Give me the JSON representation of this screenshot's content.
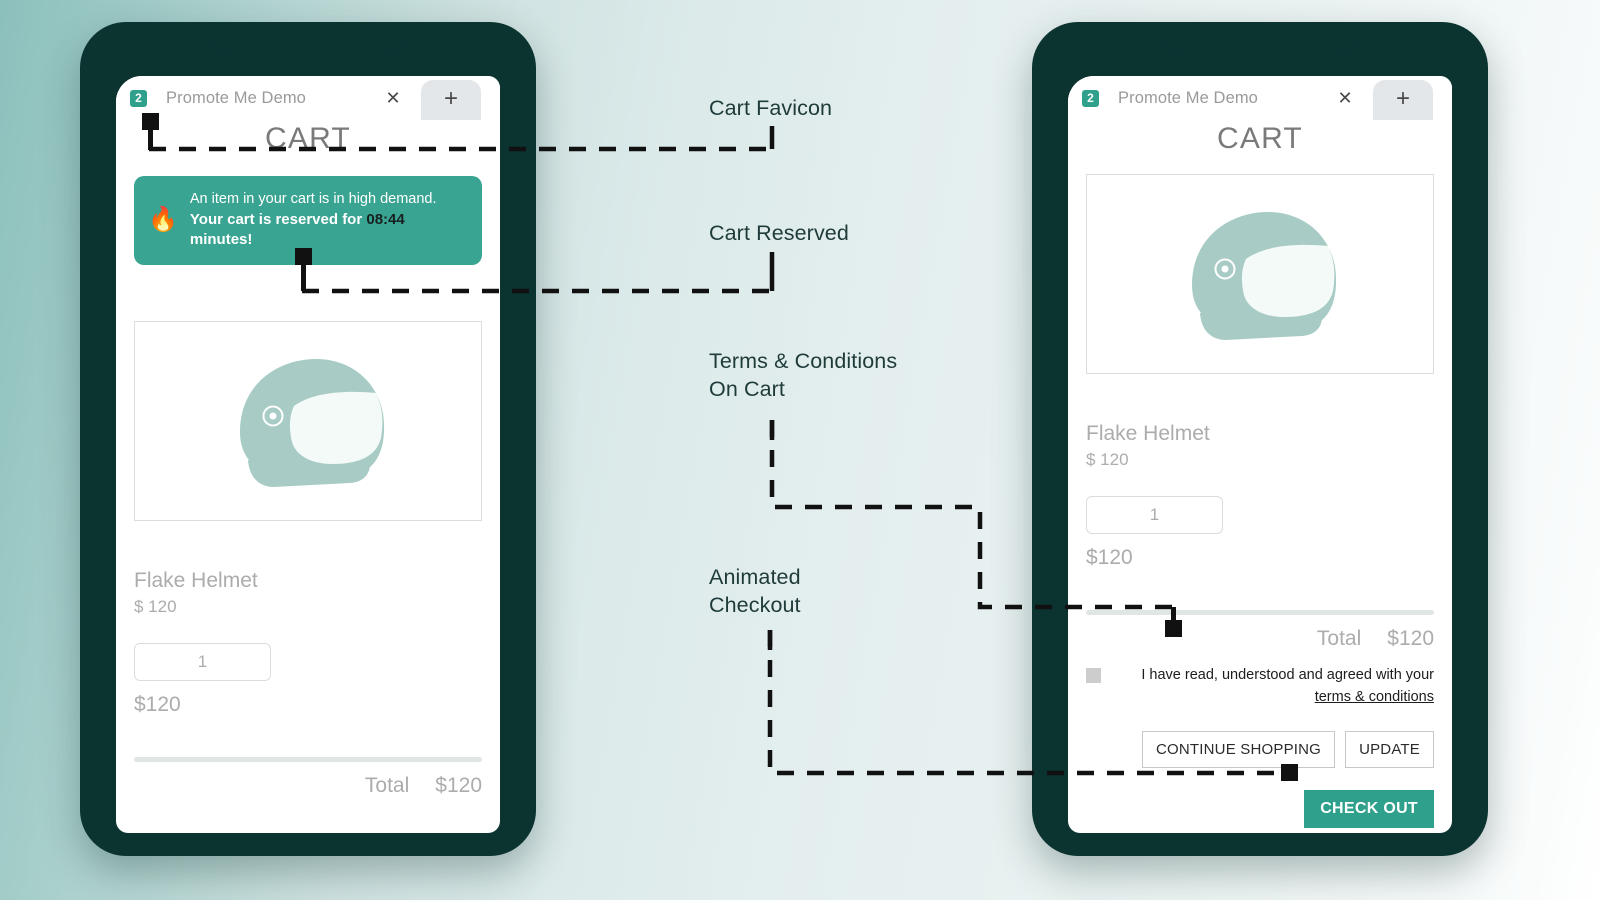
{
  "background": {
    "from": "#8cc0bc",
    "to": "#ffffff"
  },
  "theme": {
    "frame": "#0b3330",
    "accent": "#2ea08c",
    "banner": "#3aa492",
    "helmet": "#a8ccc5",
    "muted_text": "#acacac",
    "annotation_text": "#1e3b3a"
  },
  "browser": {
    "favicon_badge": "2",
    "tab_title": "Promote Me Demo",
    "close_icon": "close-icon",
    "new_tab_icon": "plus-icon"
  },
  "cart": {
    "title": "CART",
    "banner": {
      "icon": "fire-emoji",
      "line1": "An item in your cart is in high demand.",
      "line2_prefix": "Your cart is reserved for ",
      "timer": "08:44",
      "line2_suffix": " minutes!"
    },
    "product": {
      "image_alt": "helmet-illustration",
      "name": "Flake Helmet",
      "unit_price": "$ 120",
      "quantity": "1",
      "line_total": "$120"
    },
    "totals": {
      "label": "Total",
      "value": "$120"
    },
    "terms": {
      "checkbox_checked": false,
      "text_before_link": "I have read, understood and agreed with your ",
      "link_text": "terms & conditions"
    },
    "buttons": {
      "continue_shopping": "CONTINUE SHOPPING",
      "update": "UPDATE",
      "check_out": "CHECK OUT"
    }
  },
  "annotations": [
    {
      "id": "cart-favicon",
      "label": "Cart Favicon"
    },
    {
      "id": "cart-reserved",
      "label": "Cart Reserved"
    },
    {
      "id": "terms-on-cart",
      "label": "Terms & Conditions\nOn Cart"
    },
    {
      "id": "animated-checkout",
      "label": "Animated\nCheckout"
    }
  ]
}
